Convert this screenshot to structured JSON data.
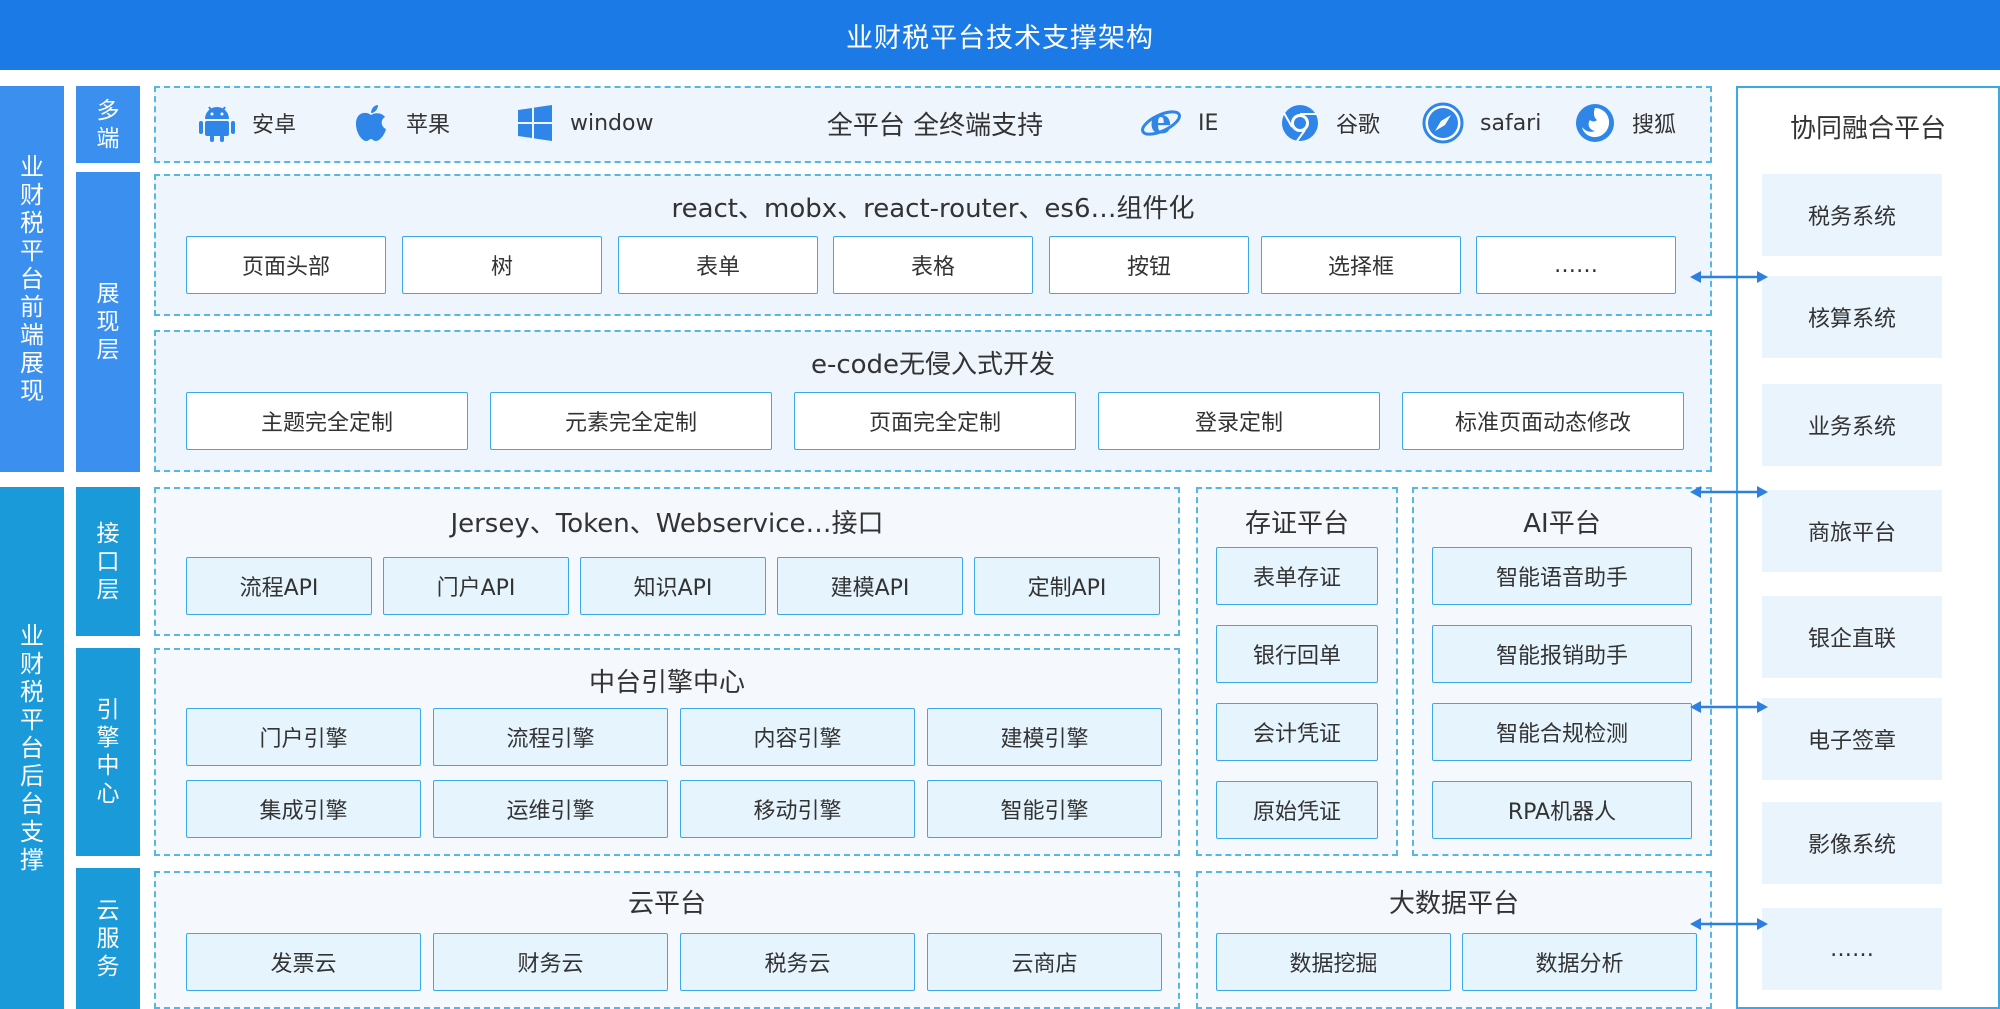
{
  "title": "业财税平台技术支撑架构",
  "side_labels": {
    "front": "业财税平台前端展现",
    "back": "业财税平台后台支撑"
  },
  "layer_tags": {
    "multi": "多端",
    "presentation": "展现层",
    "interface": "接口层",
    "engine": "引擎中心",
    "cloud": "云服务"
  },
  "platforms": {
    "center": "全平台 全终端支持",
    "items": [
      {
        "label": "安卓",
        "icon": "android-icon"
      },
      {
        "label": "苹果",
        "icon": "apple-icon"
      },
      {
        "label": "window",
        "icon": "windows-icon"
      },
      {
        "label": "IE",
        "icon": "ie-icon"
      },
      {
        "label": "谷歌",
        "icon": "chrome-icon"
      },
      {
        "label": "safari",
        "icon": "safari-icon"
      },
      {
        "label": "搜狐",
        "icon": "firefox-icon"
      }
    ]
  },
  "react_panel": {
    "title": "react、mobx、react-router、es6…组件化",
    "items": [
      "页面头部",
      "树",
      "表单",
      "表格",
      "按钮",
      "选择框",
      "……"
    ]
  },
  "ecode_panel": {
    "title": "e-code无侵入式开发",
    "items": [
      "主题完全定制",
      "元素完全定制",
      "页面完全定制",
      "登录定制",
      "标准页面动态修改"
    ]
  },
  "interface_panel": {
    "title": "Jersey、Token、Webservice…接口",
    "items": [
      "流程API",
      "门户API",
      "知识API",
      "建模API",
      "定制API"
    ]
  },
  "engine_panel": {
    "title": "中台引擎中心",
    "items": [
      "门户引擎",
      "流程引擎",
      "内容引擎",
      "建模引擎",
      "集成引擎",
      "运维引擎",
      "移动引擎",
      "智能引擎"
    ]
  },
  "evidence_panel": {
    "title": "存证平台",
    "items": [
      "表单存证",
      "银行回单",
      "会计凭证",
      "原始凭证"
    ]
  },
  "ai_panel": {
    "title": "AI平台",
    "items": [
      "智能语音助手",
      "智能报销助手",
      "智能合规检测",
      "RPA机器人"
    ]
  },
  "cloud_panel": {
    "title": "云平台",
    "items": [
      "发票云",
      "财务云",
      "税务云",
      "云商店"
    ]
  },
  "bigdata_panel": {
    "title": "大数据平台",
    "items": [
      "数据挖掘",
      "数据分析"
    ]
  },
  "right_panel": {
    "title": "协同融合平台",
    "items": [
      "税务系统",
      "核算系统",
      "业务系统",
      "商旅平台",
      "银企直联",
      "电子签章",
      "影像系统",
      "……"
    ]
  },
  "colors": {
    "title_bar": "#1b7ae6",
    "front_side": "#3a8fef",
    "back_side": "#1a9ad9",
    "border": "#3da8e6",
    "panel_bg": "#eef5fd"
  }
}
